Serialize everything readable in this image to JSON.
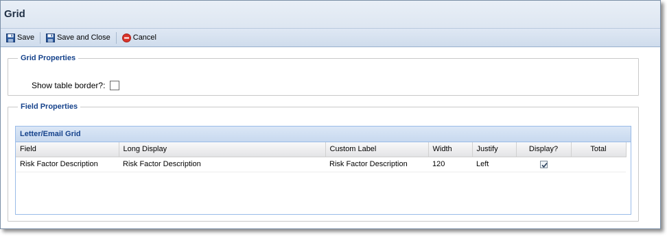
{
  "window": {
    "title": "Grid"
  },
  "toolbar": {
    "save_label": "Save",
    "save_close_label": "Save and Close",
    "cancel_label": "Cancel"
  },
  "grid_properties": {
    "legend": "Grid Properties",
    "show_border_label": "Show table border?:",
    "show_border_checked": false
  },
  "field_properties": {
    "legend": "Field Properties",
    "grid_title": "Letter/Email Grid",
    "columns": [
      "Field",
      "Long Display",
      "Custom Label",
      "Width",
      "Justify",
      "Display?",
      "Total"
    ],
    "rows": [
      {
        "field": "Risk Factor Description",
        "long_display": "Risk Factor Description",
        "custom_label": "Risk Factor Description",
        "width": "120",
        "justify": "Left",
        "display": true,
        "total": ""
      }
    ]
  },
  "icons": {
    "save": "floppy-disk-icon",
    "save_close": "floppy-disk-icon",
    "cancel": "cancel-circle-icon"
  },
  "colors": {
    "accent": "#15428b",
    "toolbar_bg": "#dfe8f4",
    "cancel_red": "#d9352b"
  }
}
